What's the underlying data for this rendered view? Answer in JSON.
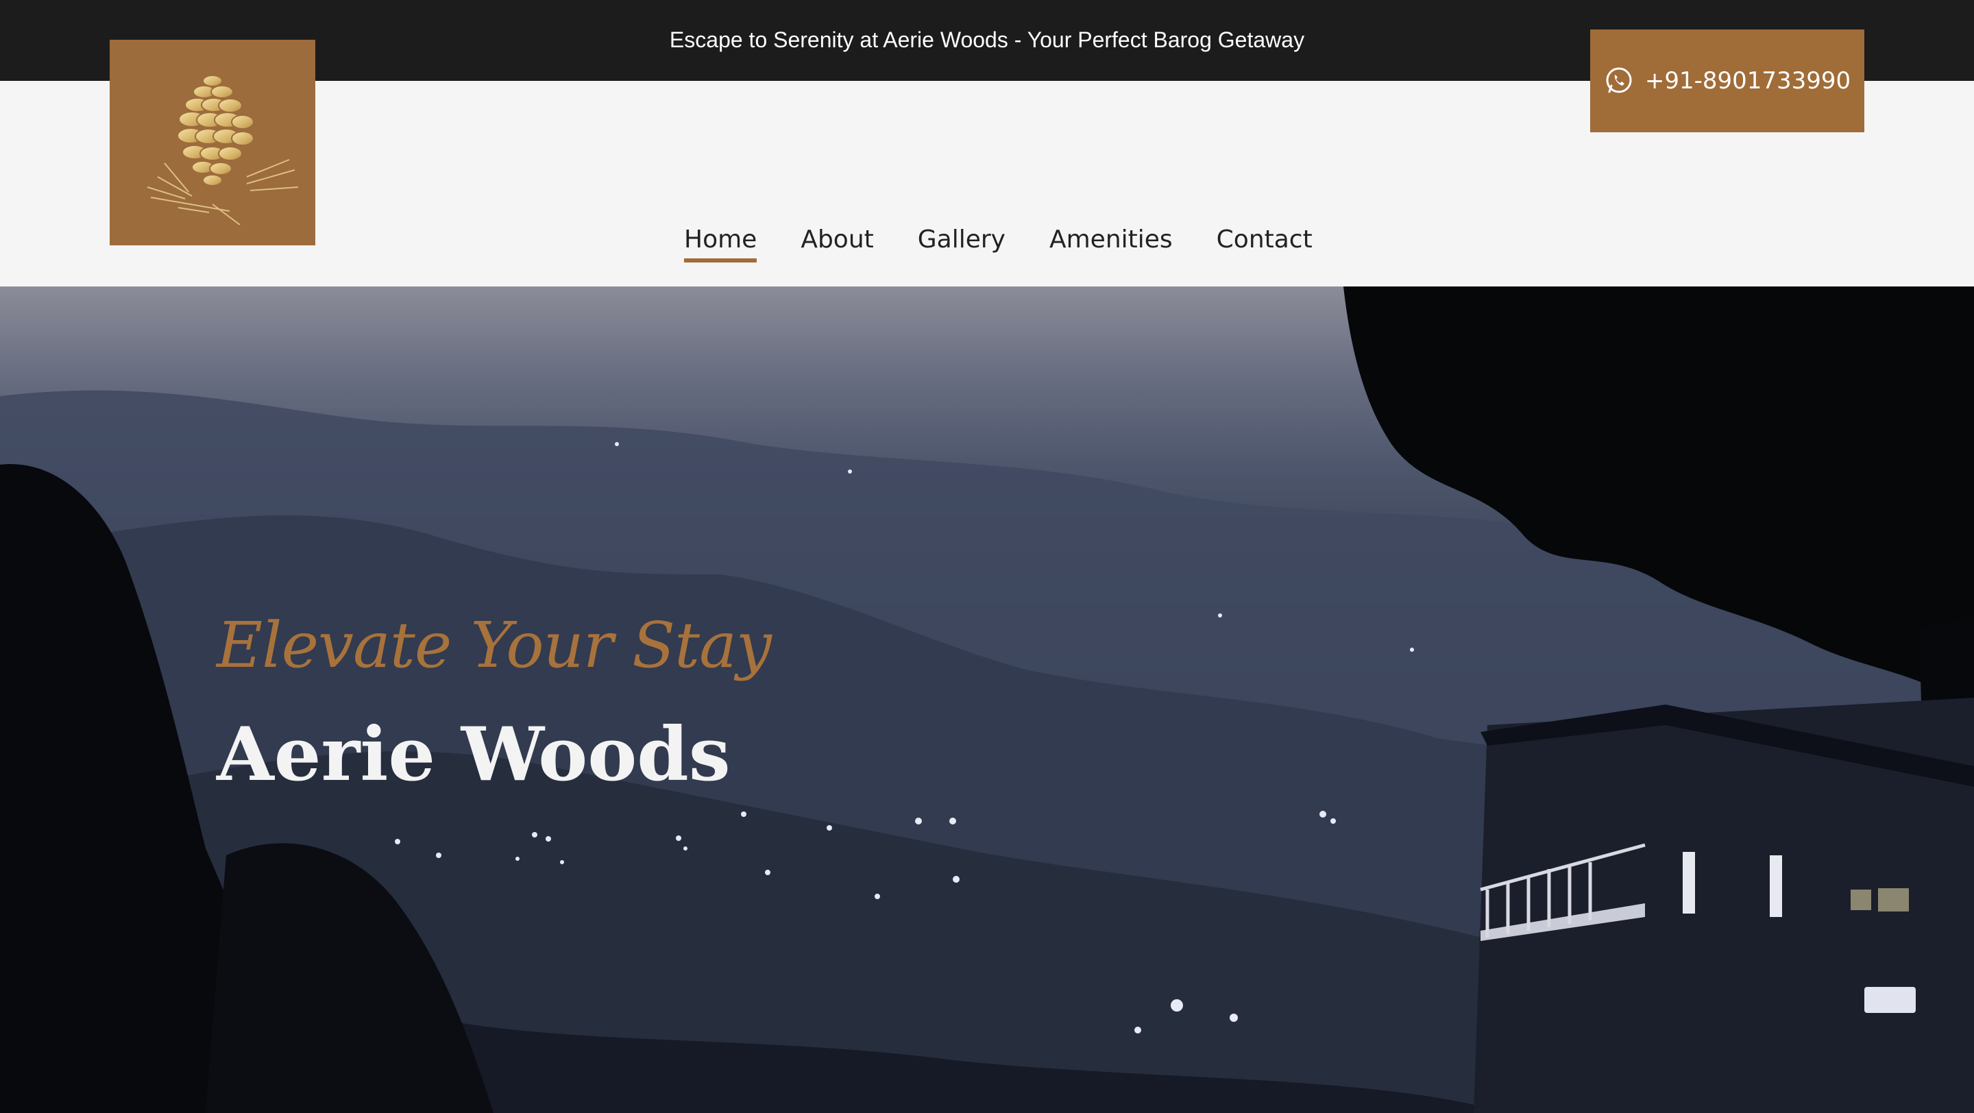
{
  "announcement": "Escape to Serenity at Aerie Woods - Your Perfect Barog Getaway",
  "logo": {
    "icon": "pine-cone-icon"
  },
  "nav": {
    "items": [
      {
        "label": "Home",
        "active": true
      },
      {
        "label": "About",
        "active": false
      },
      {
        "label": "Gallery",
        "active": false
      },
      {
        "label": "Amenities",
        "active": false
      },
      {
        "label": "Contact",
        "active": false
      }
    ]
  },
  "contact": {
    "phone": "+91-8901733990",
    "icon": "whatsapp-icon"
  },
  "hero": {
    "tagline": "Elevate Your Stay",
    "title": "Aerie Woods"
  },
  "colors": {
    "brand": "#a06c38",
    "topbar": "#1c1c1c",
    "navbar": "#f5f5f5",
    "tagline": "#a8723c"
  }
}
